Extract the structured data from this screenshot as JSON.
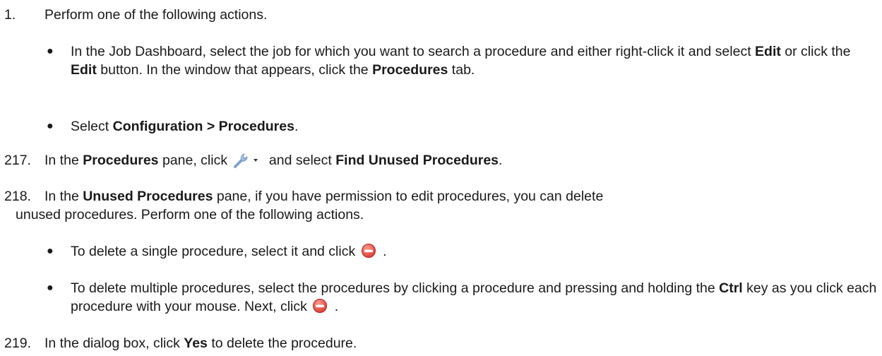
{
  "step1": {
    "number": "1.",
    "text": "Perform one of the following actions.",
    "bullets": [
      {
        "pre1": "In the Job Dashboard, select the job for which you want to search a procedure and either right-click it and select ",
        "b1": "Edit",
        "pre2": " or click the ",
        "b2": "Edit",
        "pre3": " button. In the window that appears, click the ",
        "b3": "Procedures",
        "post": " tab."
      },
      {
        "pre": "Select ",
        "b": "Configuration > Procedures",
        "post": "."
      }
    ]
  },
  "step217": {
    "number": "217.",
    "pre1": "In the ",
    "b1": "Procedures",
    "pre2": " pane, click ",
    "pre3": " and select ",
    "b2": "Find Unused Procedures",
    "post": "."
  },
  "step218": {
    "number": "218.",
    "pre1": "In the ",
    "b1": "Unused Procedures",
    "line1_rest": " pane, if you have permission to edit procedures, you can delete",
    "line2": "unused procedures. Perform one of the following actions.",
    "bullets": [
      {
        "pre": "To delete a single procedure, select it and click ",
        "post": "."
      },
      {
        "pre1": "To delete multiple procedures, select the procedures by clicking a procedure and pressing and holding the ",
        "b": "Ctrl",
        "pre2": " key as you click each procedure with your mouse. Next, click ",
        "post": "."
      }
    ]
  },
  "step219": {
    "number": "219.",
    "pre": "In the dialog box, click ",
    "b": "Yes",
    "post": " to delete the procedure."
  },
  "icons": {
    "tools": "wrench-dropdown-icon",
    "delete": "delete-minus-icon",
    "delete_color": "#e8463c"
  }
}
